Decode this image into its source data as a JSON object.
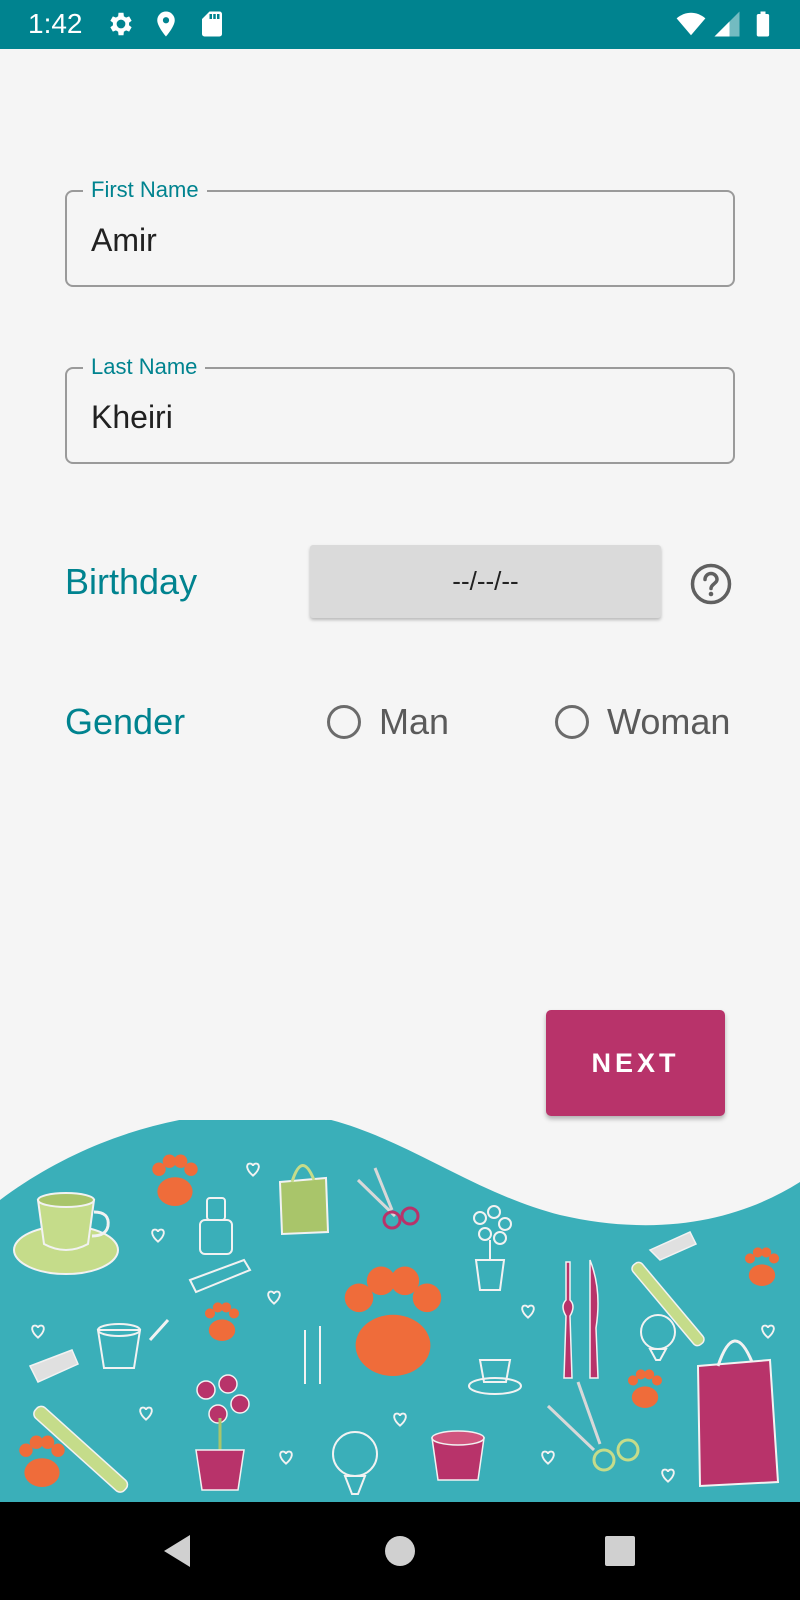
{
  "status_bar": {
    "time": "1:42",
    "left_icons": [
      "settings-icon",
      "location-icon",
      "sd-card-icon"
    ],
    "right_icons": [
      "wifi-icon",
      "signal-icon",
      "battery-icon"
    ]
  },
  "form": {
    "first_name": {
      "label": "First Name",
      "value": "Amir"
    },
    "last_name": {
      "label": "Last Name",
      "value": "Kheiri"
    },
    "birthday": {
      "label": "Birthday",
      "value": "--/--/--",
      "help_icon": "help-circle-icon"
    },
    "gender": {
      "label": "Gender",
      "options": [
        {
          "label": "Man",
          "selected": false
        },
        {
          "label": "Woman",
          "selected": false
        }
      ]
    }
  },
  "actions": {
    "next_label": "NEXT"
  },
  "nav_bar": {
    "buttons": [
      "back-icon",
      "home-icon",
      "recents-icon"
    ]
  },
  "colors": {
    "primary": "#00838f",
    "accent": "#b8336a",
    "illustration_bg": "#3aafb9",
    "illustration_orange": "#ef6c3a",
    "illustration_lime": "#c5dc8a"
  }
}
